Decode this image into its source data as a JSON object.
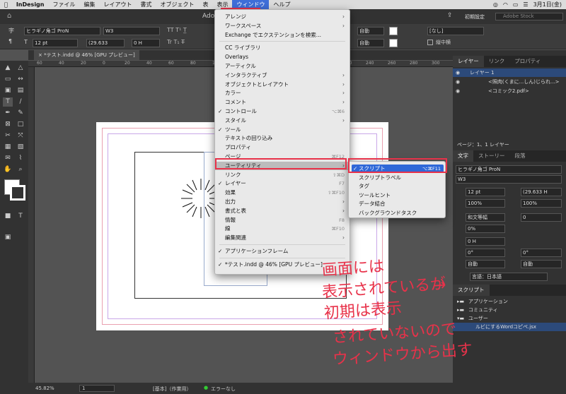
{
  "menubar": {
    "app": "InDesign",
    "items": [
      "ファイル",
      "編集",
      "レイアウト",
      "書式",
      "オブジェクト",
      "表",
      "表示",
      "ウィンドウ",
      "ヘルプ"
    ],
    "active_index": 7,
    "date": "3月1日(金)"
  },
  "appbar": {
    "title": "Adob",
    "workspace": "初期設定",
    "search_placeholder": "Adobe Stock"
  },
  "control": {
    "font": "ヒラギノ角ゴ ProN",
    "weight": "W3",
    "size": "12 pt",
    "leading": "(29.633",
    "tracking": "0 H",
    "auto1": "自動",
    "auto2": "自動",
    "none": "[なし]",
    "vertical": "縦中横"
  },
  "doc_tab": "*テスト.indd @ 46% [GPU プレビュー]",
  "ruler_labels": [
    "60",
    "40",
    "20",
    "0",
    "20",
    "40",
    "60",
    "80",
    "100",
    "120",
    "140",
    "160",
    "180",
    "200",
    "220",
    "240",
    "260",
    "280",
    "300"
  ],
  "window_menu": {
    "items": [
      {
        "label": "アレンジ",
        "arrow": true
      },
      {
        "label": "ワークスペース",
        "arrow": true
      },
      {
        "label": "Exchange でエクステンションを検索..."
      },
      {
        "sep": true
      },
      {
        "label": "CC ライブラリ"
      },
      {
        "label": "Overlays"
      },
      {
        "label": "アーティクル"
      },
      {
        "label": "インタラクティブ",
        "arrow": true
      },
      {
        "label": "オブジェクトとレイアウト",
        "arrow": true
      },
      {
        "label": "カラー",
        "arrow": true
      },
      {
        "label": "コメント",
        "arrow": true
      },
      {
        "label": "コントロール",
        "check": true,
        "shortcut": "⌥⌘6"
      },
      {
        "label": "スタイル",
        "arrow": true
      },
      {
        "label": "ツール",
        "check": true
      },
      {
        "label": "テキストの回り込み"
      },
      {
        "label": "プロパティ"
      },
      {
        "label": "ページ",
        "shortcut": "⌘F12"
      },
      {
        "label": "ユーティリティ",
        "arrow": true,
        "highlight": true
      },
      {
        "label": "リンク",
        "shortcut": "⇧⌘D"
      },
      {
        "label": "レイヤー",
        "check": true,
        "shortcut": "F7"
      },
      {
        "label": "効果",
        "shortcut": "⇧⌘F10"
      },
      {
        "label": "出力",
        "arrow": true
      },
      {
        "label": "書式と表",
        "arrow": true
      },
      {
        "label": "情報",
        "shortcut": "F8"
      },
      {
        "label": "線",
        "shortcut": "⌘F10"
      },
      {
        "label": "編集関連",
        "arrow": true
      },
      {
        "sep": true
      },
      {
        "label": "アプリケーションフレーム",
        "check": true
      },
      {
        "sep": true
      },
      {
        "label": "*テスト.indd @ 46% [GPU プレビュー]",
        "check": true
      }
    ]
  },
  "utility_submenu": {
    "items": [
      {
        "label": "スクリプト",
        "check": true,
        "shortcut": "⌥⌘F11",
        "highlight": true
      },
      {
        "label": "スクリプトラベル"
      },
      {
        "label": "タグ"
      },
      {
        "label": "ツールヒント"
      },
      {
        "label": "データ結合"
      },
      {
        "label": "バックグラウンドタスク"
      }
    ]
  },
  "layers_panel": {
    "tabs": [
      "レイヤー",
      "リンク",
      "プロパティ"
    ],
    "rows": [
      "レイヤー 1",
      "<照肉(くまに...しん)じられ...>",
      "<コミック2.pdf>"
    ],
    "footer": "ページ：1、1 レイヤー"
  },
  "char_panel": {
    "tabs": [
      "文字",
      "ストーリー",
      "段落"
    ],
    "font": "ヒラギノ角ゴ ProN",
    "weight": "W3",
    "size": "12 pt",
    "leading": "(29.633 H",
    "hscale": "100%",
    "vscale": "100%",
    "mojikumi": "和文等幅",
    "tracking": "0",
    "tsume": "0%",
    "baseline": "0 H",
    "rot1": "0°",
    "rot2": "0°",
    "auto1": "自動",
    "auto2": "自動",
    "language": "言語：日本語"
  },
  "scripts_panel": {
    "title": "スクリプト",
    "items": [
      "アプリケーション",
      "コミュニティ",
      "ユーザー",
      "ルビにするWordコピペ.jsx"
    ]
  },
  "status": {
    "zoom": "45.82%",
    "page": "1",
    "style": "[基本]（作業用）",
    "errors": "エラーなし"
  },
  "annotation": {
    "lines": [
      "画面には",
      "表示されているが",
      "初期は表示",
      "されていないので",
      "ウィンドウから出す"
    ],
    "arrow": "→"
  },
  "colors": {
    "annotation": "#e8324a",
    "highlight": "#2f68d8"
  }
}
